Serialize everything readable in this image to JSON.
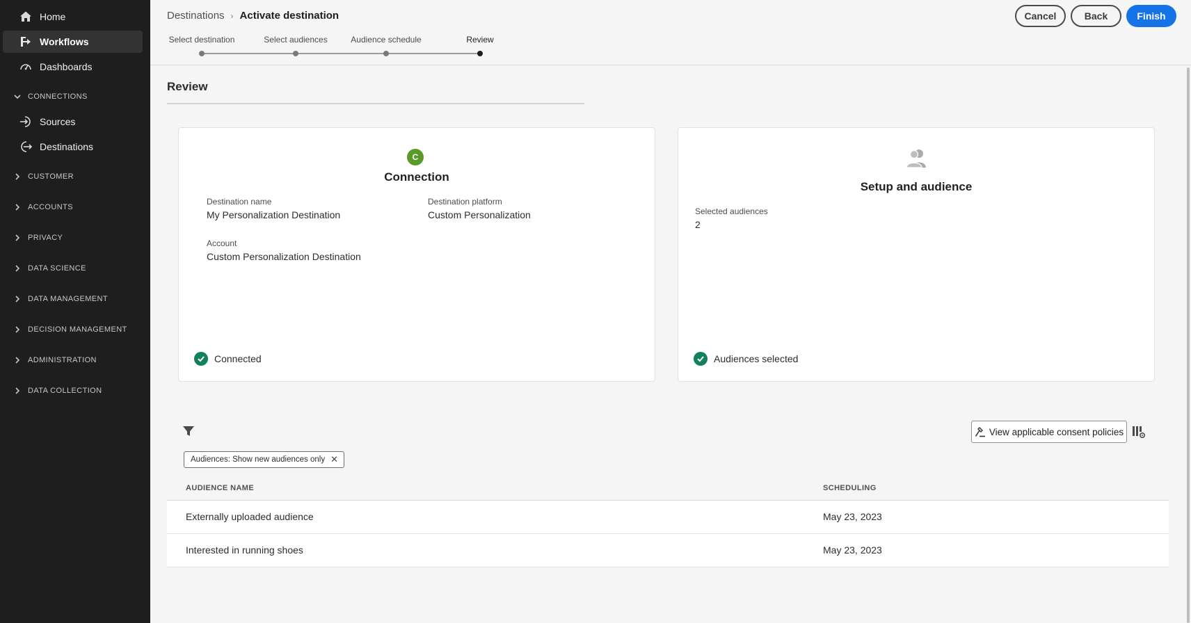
{
  "sidebar": {
    "items": [
      {
        "label": "Home",
        "icon": "home-icon"
      },
      {
        "label": "Workflows",
        "icon": "workflow-icon"
      },
      {
        "label": "Dashboards",
        "icon": "dashboard-icon"
      }
    ],
    "connections_label": "CONNECTIONS",
    "connections_items": [
      {
        "label": "Sources",
        "icon": "sources-icon"
      },
      {
        "label": "Destinations",
        "icon": "destinations-icon"
      }
    ],
    "sections": [
      "CUSTOMER",
      "ACCOUNTS",
      "PRIVACY",
      "DATA SCIENCE",
      "DATA MANAGEMENT",
      "DECISION MANAGEMENT",
      "ADMINISTRATION",
      "DATA COLLECTION"
    ]
  },
  "header": {
    "breadcrumb_parent": "Destinations",
    "breadcrumb_current": "Activate destination",
    "cancel_label": "Cancel",
    "back_label": "Back",
    "finish_label": "Finish"
  },
  "steps": [
    "Select destination",
    "Select audiences",
    "Audience schedule",
    "Review"
  ],
  "review": {
    "title": "Review",
    "connection_card": {
      "badge_letter": "C",
      "title": "Connection",
      "destination_name_label": "Destination name",
      "destination_name_value": "My Personalization Destination",
      "destination_platform_label": "Destination platform",
      "destination_platform_value": "Custom Personalization",
      "account_label": "Account",
      "account_value": "Custom Personalization Destination",
      "status": "Connected"
    },
    "setup_card": {
      "title": "Setup and audience",
      "selected_audiences_label": "Selected audiences",
      "selected_audiences_value": "2",
      "status": "Audiences selected"
    }
  },
  "toolbar": {
    "filter_chip": "Audiences: Show new audiences only",
    "consent_button": "View applicable consent policies"
  },
  "table": {
    "columns": [
      "AUDIENCE NAME",
      "SCHEDULING"
    ],
    "rows": [
      {
        "name": "Externally uploaded audience",
        "scheduling": "May 23, 2023"
      },
      {
        "name": "Interested in running shoes",
        "scheduling": "May 23, 2023"
      }
    ]
  },
  "colors": {
    "primary": "#1473e6",
    "success": "#12805c",
    "badge": "#5a9a2a",
    "sidebar_bg": "#1e1e1e"
  }
}
